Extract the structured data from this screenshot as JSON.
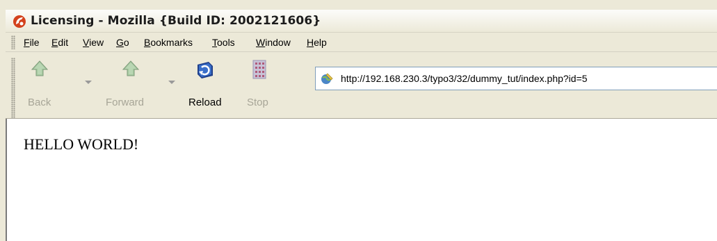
{
  "window": {
    "title": "Licensing - Mozilla {Build ID: 2002121606}"
  },
  "menubar": {
    "items": [
      {
        "acc": "F",
        "rest": "ile"
      },
      {
        "acc": "E",
        "rest": "dit"
      },
      {
        "acc": "V",
        "rest": "iew"
      },
      {
        "acc": "G",
        "rest": "o"
      },
      {
        "acc": "B",
        "rest": "ookmarks"
      },
      {
        "acc": "T",
        "rest": "ools"
      },
      {
        "acc": "W",
        "rest": "indow"
      },
      {
        "acc": "H",
        "rest": "elp"
      }
    ]
  },
  "toolbar": {
    "back_label": "Back",
    "forward_label": "Forward",
    "reload_label": "Reload",
    "stop_label": "Stop",
    "url": "http://192.168.230.3/typo3/32/dummy_tut/index.php?id=5"
  },
  "page": {
    "body_text": "HELLO WORLD!"
  },
  "icons": {
    "title": "mozilla-logo-icon",
    "back": "back-arrow-icon",
    "forward": "forward-arrow-icon",
    "reload": "reload-icon",
    "stop": "stop-icon",
    "url": "page-proxy-icon"
  },
  "colors": {
    "chrome": "#ece9d8",
    "disabled_text": "#a7a597",
    "url_border": "#7f9db9"
  }
}
